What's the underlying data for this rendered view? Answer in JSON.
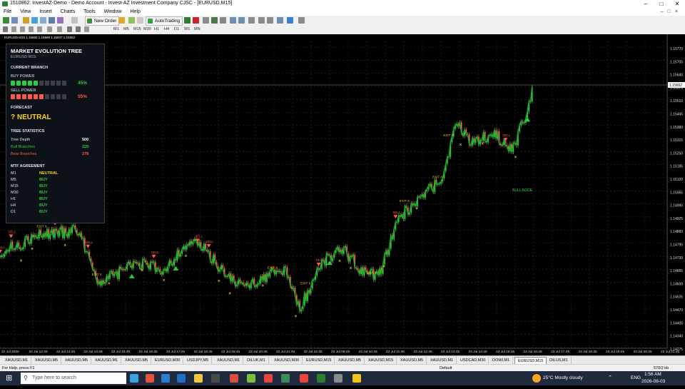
{
  "window": {
    "title": "1510862: InvestAZ-Demo - Demo Account - Invest-AZ Investment Company CJSC - [EURUSD,M15]"
  },
  "menu": [
    "File",
    "View",
    "Insert",
    "Charts",
    "Tools",
    "Window",
    "Help"
  ],
  "toolbar": {
    "new_order": "New Order",
    "auto_trading": "AutoTrading",
    "timeframes": [
      "M1",
      "M5",
      "M15",
      "M30",
      "H1",
      "H4",
      "D1",
      "W1",
      "MN"
    ]
  },
  "chart": {
    "info": "EURUSD,M15  1.15660 1.15669 1.15637 1.15652",
    "current_price": "1.15652",
    "price_labels": [
      "1.15770",
      "1.15705",
      "1.15640",
      "1.15575",
      "1.15510",
      "1.15445",
      "1.15380",
      "1.15315",
      "1.15250",
      "1.15185",
      "1.15120",
      "1.15055",
      "1.14990",
      "1.14925",
      "1.14860",
      "1.14795",
      "1.14730",
      "1.14665",
      "1.14600",
      "1.14535",
      "1.14470",
      "1.14405",
      "1.14340",
      "1.14275"
    ],
    "time_labels": [
      "22 Jul 2026",
      "22 Jul 12:45",
      "22 Jul 13:45",
      "22 Jul 14:45",
      "22 Jul 15:45",
      "22 Jul 16:45",
      "22 Jul 17:45",
      "22 Jul 18:45",
      "22 Jul 19:45",
      "22 Jul 20:45",
      "22 Jul 21:45",
      "22 Jul 22:45",
      "23 Jul 09:45",
      "23 Jul 10:45",
      "23 Jul 11:45",
      "23 Jul 12:45",
      "23 Jul 13:45",
      "23 Jul 14:45",
      "23 Jul 15:45",
      "23 Jul 16:45",
      "23 Jul 17:45",
      "23 Jul 18:45",
      "23 Jul 19:45",
      "23 Jul 20:45",
      "23 Jul 21:45"
    ],
    "signal_labels": {
      "exit": "EXIT X",
      "sell": "SELL",
      "node": "BULL NODE"
    }
  },
  "panel": {
    "title": "MARKET EVOLUTION TREE",
    "symbol": "EURUSD  M15",
    "current_branch": "CURRENT BRANCH",
    "buy_label": "BUY POWER",
    "buy_pct": "45%",
    "buy_level": 0.45,
    "sell_label": "SELL POWER",
    "sell_pct": "55%",
    "sell_level": 0.55,
    "forecast_label": "FORECAST",
    "forecast": "? NEUTRAL",
    "stats_title": "TREE STATISTICS",
    "stats": [
      {
        "label": "Tree Depth",
        "value": "500"
      },
      {
        "label": "Bull Branches",
        "value": "220"
      },
      {
        "label": "Bear Branches",
        "value": "278"
      }
    ],
    "mtf_title": "MTF AGREEMENT",
    "mtf": [
      {
        "tf": "M1",
        "signal": "NEUTRAL"
      },
      {
        "tf": "M5",
        "signal": "BUY"
      },
      {
        "tf": "M15",
        "signal": "BUY"
      },
      {
        "tf": "M30",
        "signal": "BUY"
      },
      {
        "tf": "H1",
        "signal": "BUY"
      },
      {
        "tf": "H4",
        "signal": "BUY"
      },
      {
        "tf": "D1",
        "signal": "BUY"
      }
    ],
    "colors": {
      "buy": "#2ecc40",
      "sell": "#ff5a4a",
      "neutral": "#f5d31f"
    }
  },
  "tabs": [
    "XAUUSD,M1",
    "XAUUSD,M5",
    "XAUUSD,M5",
    "XAUUSD,M1",
    "XAUUSD,M5",
    "EURUSD,M30",
    "USDJPY,M5",
    "XAUUSD,M1",
    "OILUK,M1",
    "XAUUSD,M30",
    "EURUSD,M15",
    "XAUUSD,M5",
    "XAUUSD,M15",
    "XAUUSD,M5",
    "XAUUSD,M1",
    "USDCAD,M30",
    "DOWI,M1",
    "EURUSD,M15",
    "OILUS,M1"
  ],
  "active_tab": 17,
  "status": {
    "help": "For Help, press F1",
    "profile": "Default",
    "traffic": "570/2 kb"
  },
  "taskbar": {
    "search_placeholder": "Type here to search",
    "weather": "25°C  Mostly cloudy",
    "lang": "ENG",
    "time": "1:56 AM",
    "date": "2026-08-03"
  }
}
